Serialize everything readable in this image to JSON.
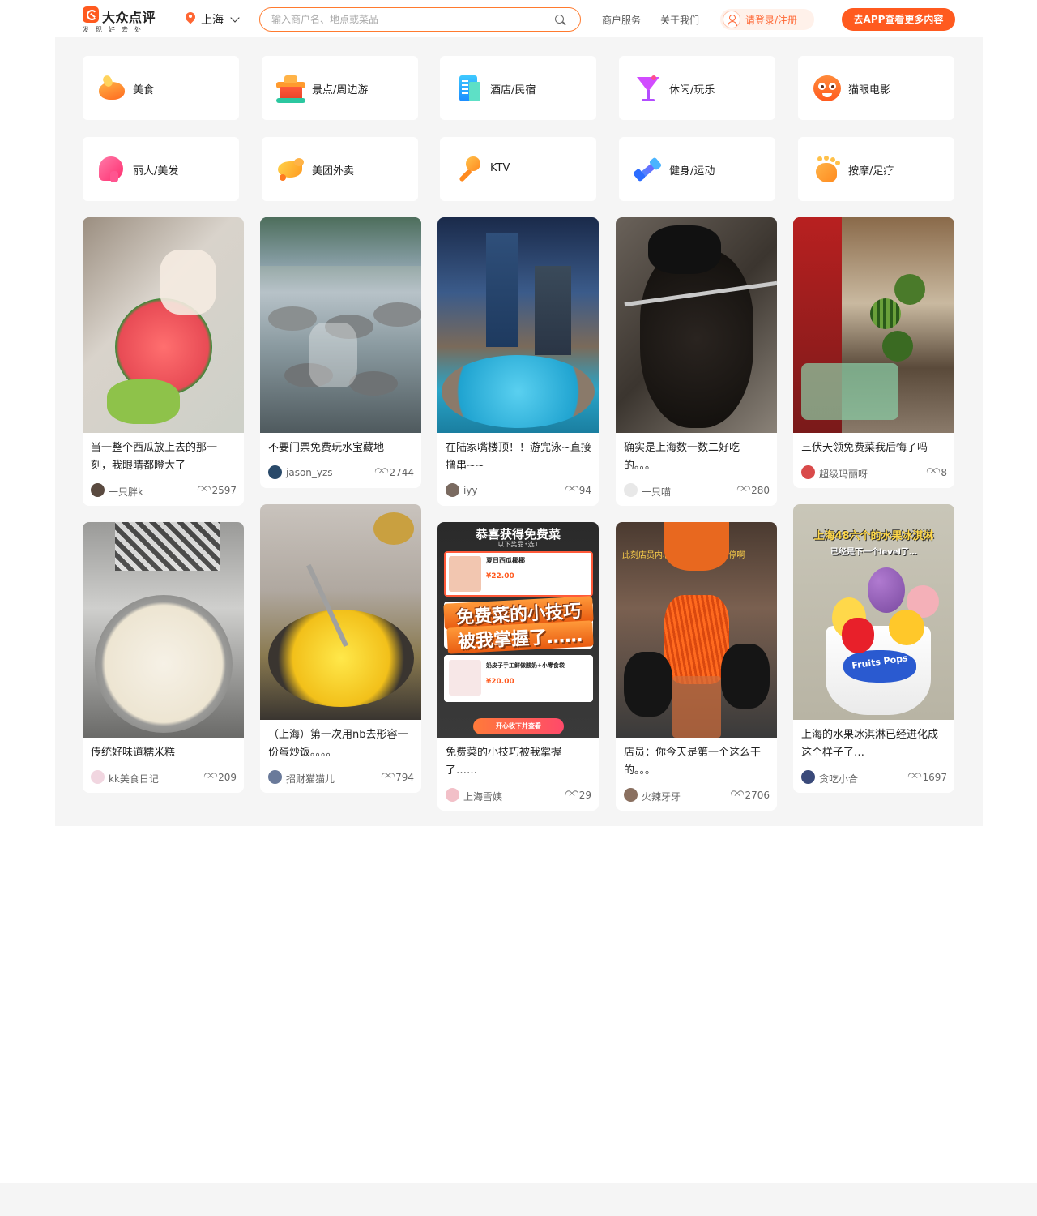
{
  "header": {
    "logo_name": "大众点评",
    "logo_slogan": "发现好去处",
    "city": "上海",
    "search_placeholder": "输入商户名、地点或菜品",
    "nav": [
      "商户服务",
      "关于我们"
    ],
    "login": "请登录/注册",
    "app_button": "去APP查看更多内容",
    "accent_color": "#ff5a1f"
  },
  "categories": [
    {
      "label": "美食",
      "icon": "roast-chicken-icon"
    },
    {
      "label": "景点/周边游",
      "icon": "pavilion-icon"
    },
    {
      "label": "酒店/民宿",
      "icon": "hotel-building-icon"
    },
    {
      "label": "休闲/玩乐",
      "icon": "cocktail-icon"
    },
    {
      "label": "猫眼电影",
      "icon": "cat-eye-movie-icon"
    },
    {
      "label": "丽人/美发",
      "icon": "beauty-hair-icon"
    },
    {
      "label": "美团外卖",
      "icon": "kangaroo-delivery-icon"
    },
    {
      "label": "KTV",
      "icon": "microphone-icon"
    },
    {
      "label": "健身/运动",
      "icon": "dumbbell-icon"
    },
    {
      "label": "按摩/足疗",
      "icon": "foot-massage-icon"
    }
  ],
  "feed": [
    {
      "title": "当一整个西瓜放上去的那一刻，我眼睛都瞪大了",
      "author": "一只胖k",
      "likes": "2597"
    },
    {
      "title": "不要门票免费玩水宝藏地",
      "author": "jason_yzs",
      "likes": "2744"
    },
    {
      "title": "在陆家嘴楼顶！！游完泳~直接撸串~~",
      "author": "iyy",
      "likes": "94"
    },
    {
      "title": "确实是上海数一数二好吃的。。。",
      "author": "一只喵",
      "likes": "280"
    },
    {
      "title": "三伏天领免费菜我后悔了吗",
      "author": "超级玛丽呀",
      "likes": "8"
    },
    {
      "title": "传统好味道糯米糕",
      "author": "kk美食日记",
      "likes": "209"
    },
    {
      "title": "（上海）第一次用nb去形容一份蛋炒饭。。。。",
      "author": "招财猫猫儿",
      "likes": "794"
    },
    {
      "title": "免费菜的小技巧被我掌握了……",
      "author": "上海雪姨",
      "likes": "29"
    },
    {
      "title": "店员：你今天是第一个这么干的。。。",
      "author": "火辣牙牙",
      "likes": "2706"
    },
    {
      "title": "上海的水果冰淇淋已经进化成这个样子了…",
      "author": "贪吃小合",
      "likes": "1697"
    }
  ],
  "image_overlays": {
    "free_dish_header": "恭喜获得免费菜",
    "free_dish_sub": "以下奖品3选1",
    "free_dish_item1": "夏日西瓜椰椰",
    "free_dish_item1_price": "¥22.00",
    "free_dish_banner_1": "免费菜的小技巧",
    "free_dish_banner_2": "被我掌握了……",
    "free_dish_item2": "奶皮子手工鲜做酸奶+小零食袋",
    "free_dish_item2_price": "¥20.00",
    "free_dish_button": "开心收下并查看",
    "clerk_caption": "此刻店员内心os：怎么还不喊停啊",
    "icecream_title": "上海48六个的水果冰淇淋",
    "icecream_sub": "已经是下一个level了…",
    "icecream_brand": "Fruits Pops"
  }
}
